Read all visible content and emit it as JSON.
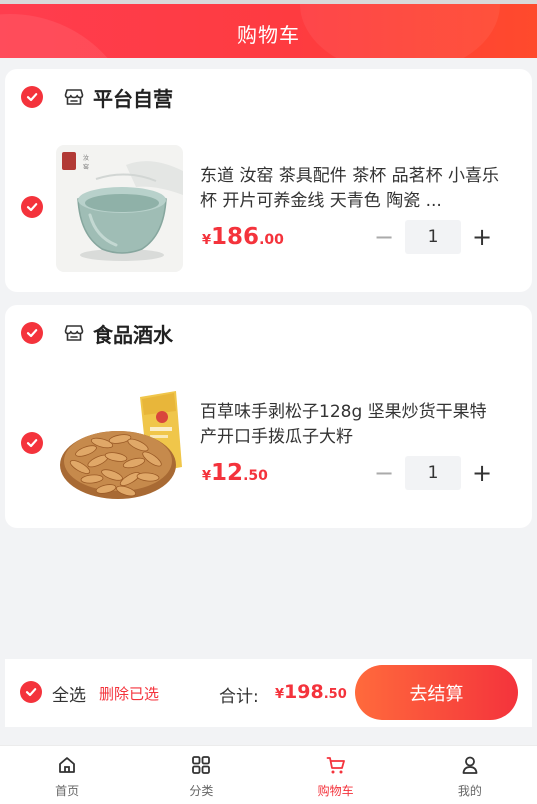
{
  "header": {
    "title": "购物车"
  },
  "colors": {
    "accent": "#f4333c",
    "header_start": "#ff3d4e",
    "header_end": "#ff4a2c"
  },
  "shops": [
    {
      "name": "平台自营",
      "checked": true,
      "item": {
        "checked": true,
        "title": "东道 汝窑 茶具配件 茶杯 品茗杯 小喜乐杯 开片可养金线 天青色 陶瓷 ...",
        "price": {
          "currency": "¥",
          "int": "186",
          "dec": ".00"
        },
        "quantity": "1",
        "minus": "−",
        "plus": "+"
      }
    },
    {
      "name": "食品酒水",
      "checked": true,
      "item": {
        "checked": true,
        "title": "百草味手剥松子128g 坚果炒货干果特产开口手拨瓜子大籽",
        "price": {
          "currency": "¥",
          "int": "12",
          "dec": ".50"
        },
        "quantity": "1",
        "minus": "−",
        "plus": "+"
      }
    }
  ],
  "checkout": {
    "select_all": "全选",
    "delete_selected": "删除已选",
    "total_label": "合计:",
    "total": {
      "currency": "¥",
      "int": "198",
      "dec": ".50"
    },
    "button": "去结算"
  },
  "tabbar": [
    {
      "label": "首页",
      "icon": "home-icon",
      "active": false
    },
    {
      "label": "分类",
      "icon": "grid-icon",
      "active": false
    },
    {
      "label": "购物车",
      "icon": "cart-icon",
      "active": true
    },
    {
      "label": "我的",
      "icon": "user-icon",
      "active": false
    }
  ]
}
